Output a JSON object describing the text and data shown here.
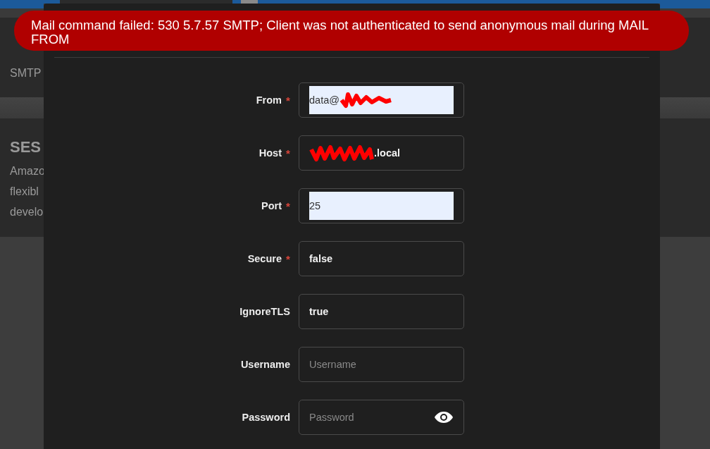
{
  "toast": {
    "message": "Mail command failed: 530 5.7.57 SMTP; Client was not authenticated to send anonymous mail during MAIL FROM"
  },
  "background": {
    "cards": [
      {
        "lines": [
          "SMTP"
        ]
      },
      {
        "title": "SES",
        "lines": [
          "Amazo",
          "flexibl",
          "develo"
        ]
      }
    ]
  },
  "form": {
    "fields": [
      {
        "label": "From",
        "required_mark": "*",
        "kind": "text",
        "value": "data@",
        "redacted_suffix": true,
        "autofilled": true
      },
      {
        "label": "Host",
        "required_mark": "*",
        "kind": "text",
        "value": ".local",
        "redacted_prefix": true,
        "autofilled": false
      },
      {
        "label": "Port",
        "required_mark": "*",
        "kind": "text",
        "value": "25",
        "autofilled": true
      },
      {
        "label": "Secure",
        "required_mark": "*",
        "kind": "text",
        "value": "false",
        "autofilled": false
      },
      {
        "label": "IgnoreTLS",
        "kind": "text",
        "value": "true",
        "autofilled": false
      },
      {
        "label": "Username",
        "kind": "text",
        "placeholder": "Username",
        "autofilled": false
      },
      {
        "label": "Password",
        "kind": "password",
        "placeholder": "Password",
        "autofilled": false
      }
    ]
  }
}
